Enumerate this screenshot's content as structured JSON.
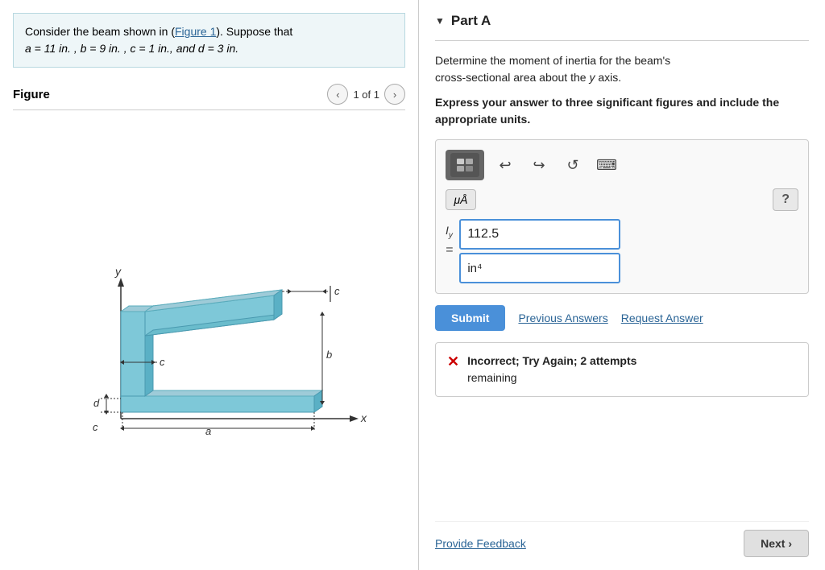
{
  "left": {
    "problem": {
      "text_before": "Consider the beam shown in (",
      "link_text": "Figure 1",
      "text_after": "). Suppose that",
      "math_line": "a = 11  in. , b = 9  in. , c = 1 in., and d = 3  in."
    },
    "figure": {
      "label": "Figure",
      "nav_text": "1 of 1",
      "prev_label": "‹",
      "next_label": "›"
    }
  },
  "right": {
    "part": {
      "title": "Part A",
      "collapse_arrow": "▼"
    },
    "question": {
      "line1": "Determine the moment of inertia for the beam's",
      "line2": "cross-sectional area about the y axis.",
      "instruction": "Express your answer to three significant figures and include the appropriate units."
    },
    "toolbar": {
      "undo_icon": "↩",
      "redo_icon": "↪",
      "reset_icon": "↺",
      "keyboard_icon": "⌨",
      "mu_label": "μÅ",
      "help_label": "?"
    },
    "input": {
      "label_top": "I",
      "label_sub": "y",
      "equals": "=",
      "value": "112.5",
      "units": "in⁴"
    },
    "actions": {
      "submit_label": "Submit",
      "previous_label": "Previous Answers",
      "request_label": "Request Answer"
    },
    "feedback": {
      "icon": "✕",
      "text_bold": "Incorrect; Try Again; 2 attempts",
      "text_normal": "remaining"
    },
    "bottom": {
      "feedback_link": "Provide Feedback",
      "next_label": "Next ›"
    }
  }
}
